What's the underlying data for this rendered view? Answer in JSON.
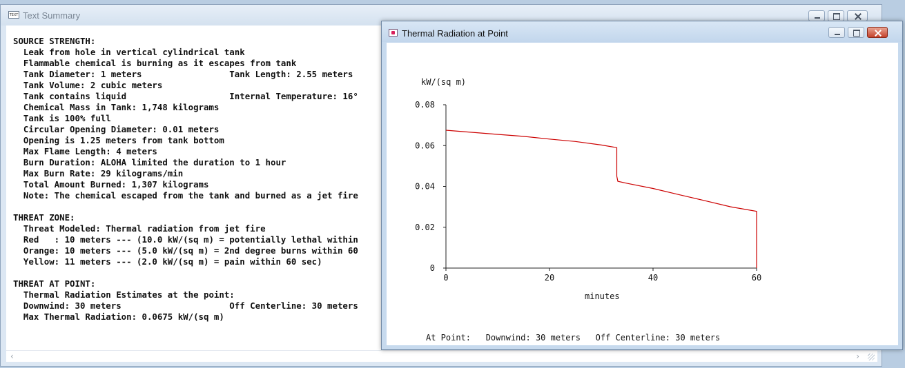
{
  "summary_window": {
    "title": "Text Summary",
    "lines": [
      "SOURCE STRENGTH:",
      "  Leak from hole in vertical cylindrical tank",
      "  Flammable chemical is burning as it escapes from tank",
      "  Tank Diameter: 1 meters                 Tank Length: 2.55 meters",
      "  Tank Volume: 2 cubic meters",
      "  Tank contains liquid                    Internal Temperature: 16°",
      "  Chemical Mass in Tank: 1,748 kilograms",
      "  Tank is 100% full",
      "  Circular Opening Diameter: 0.01 meters",
      "  Opening is 1.25 meters from tank bottom",
      "  Max Flame Length: 4 meters",
      "  Burn Duration: ALOHA limited the duration to 1 hour",
      "  Max Burn Rate: 29 kilograms/min",
      "  Total Amount Burned: 1,307 kilograms",
      "  Note: The chemical escaped from the tank and burned as a jet fire",
      "",
      "THREAT ZONE:",
      "  Threat Modeled: Thermal radiation from jet fire",
      "  Red   : 10 meters --- (10.0 kW/(sq m) = potentially lethal within",
      "  Orange: 10 meters --- (5.0 kW/(sq m) = 2nd degree burns within 60",
      "  Yellow: 11 meters --- (2.0 kW/(sq m) = pain within 60 sec)",
      "",
      "THREAT AT POINT:",
      "  Thermal Radiation Estimates at the point:",
      "  Downwind: 30 meters                     Off Centerline: 30 meters",
      "  Max Thermal Radiation: 0.0675 kW/(sq m)"
    ]
  },
  "plot_window": {
    "title": "Thermal Radiation at Point",
    "footer": "At Point:   Downwind: 30 meters   Off Centerline: 30 meters"
  },
  "colors": {
    "series": "#cc0000",
    "axis": "#222222"
  },
  "chart_data": {
    "type": "line",
    "ylabel": "kW/(sq m)",
    "xlabel": "minutes",
    "xlim": [
      0,
      60
    ],
    "ylim": [
      0,
      0.08
    ],
    "x_ticks": [
      "0",
      "20",
      "40",
      "60"
    ],
    "y_ticks": [
      "0",
      "0.02",
      "0.04",
      "0.06",
      "0.08"
    ],
    "grid": false,
    "series": [
      {
        "x": [
          0,
          5,
          10,
          15,
          20,
          25,
          30,
          33,
          33,
          33.2,
          35,
          40,
          45,
          50,
          55,
          60,
          60
        ],
        "y": [
          0.0675,
          0.0665,
          0.0655,
          0.0645,
          0.0632,
          0.062,
          0.0603,
          0.059,
          0.045,
          0.0425,
          0.0415,
          0.039,
          0.036,
          0.033,
          0.03,
          0.0278,
          0
        ]
      }
    ]
  }
}
